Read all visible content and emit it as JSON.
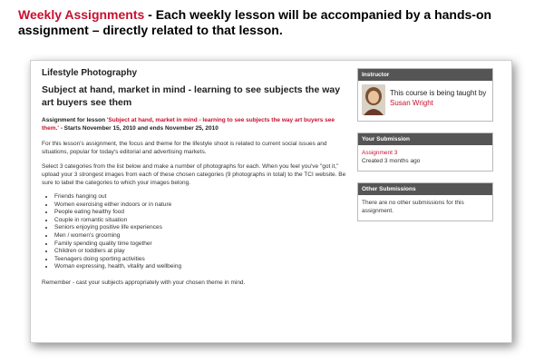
{
  "slide": {
    "title_red": "Weekly Assignments",
    "title_rest": " - Each weekly lesson will be accompanied by a hands-on assignment – directly related to that lesson."
  },
  "course": {
    "title": "Lifestyle Photography",
    "lesson_title": "Subject at hand, market in mind - learning to see subjects the way art buyers see them"
  },
  "assignment": {
    "prefix": "Assignment for lesson ",
    "lesson_link": "'Subject at hand, market in mind - learning to see subjects the way art buyers see them.'",
    "dates": " - Starts November 15, 2010 and ends November 25, 2010",
    "para1": "For this lesson's assignment, the focus and theme for the lifestyle shoot is related to current social issues and situations, popular for today's editorial and advertising markets.",
    "para2": "Select 3 categories from the list below and make a number of photographs for each.  When you feel you've \"got it,\" upload your 3 strongest images from each of these chosen categories (9 photographs in total) to the TCI website.  Be sure to label the categories to which your images belong.",
    "categories": [
      "Friends hanging out",
      "Women exercising either indoors or in nature",
      "People eating healthy food",
      "Couple in romantic situation",
      "Seniors enjoying positive life experiences",
      "Men / women's grooming",
      "Family spending quality time together",
      "Children or toddlers at play",
      "Teenagers doing sporting activities",
      "Woman expressing, health, vitality and wellbeing"
    ],
    "closing": "Remember - cast your subjects appropriately with your chosen theme in mind."
  },
  "sidebar": {
    "instructor": {
      "heading": "Instructor",
      "text": "This course is being taught by ",
      "name": "Susan Wright"
    },
    "submission": {
      "heading": "Your Submission",
      "link": "Assignment 3",
      "created": "Created 3 months ago"
    },
    "other": {
      "heading": "Other Submissions",
      "text": "There are no other submissions for this assignment."
    }
  },
  "colors": {
    "accent_red": "#c8102e",
    "box_header": "#555555"
  }
}
